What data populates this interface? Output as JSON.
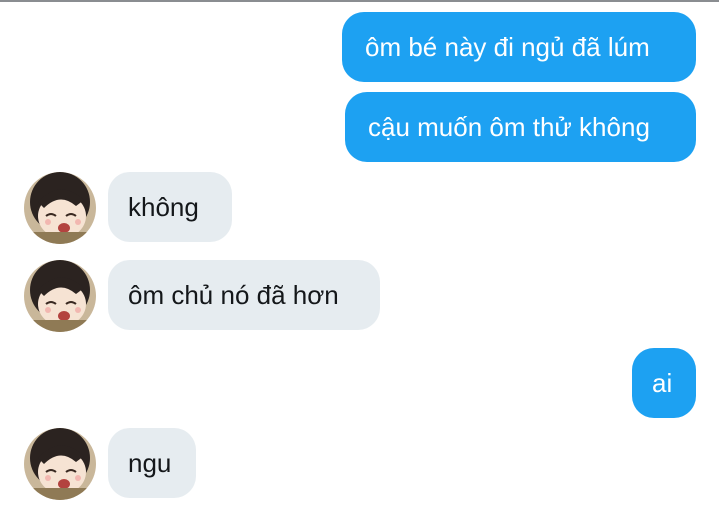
{
  "conversation": {
    "messages": [
      {
        "direction": "outgoing",
        "text": "ôm bé này đi ngủ đã lúm"
      },
      {
        "direction": "outgoing",
        "text": "cậu muốn ôm thử không"
      },
      {
        "direction": "incoming",
        "text": "không",
        "avatar": "anime-girl-avatar"
      },
      {
        "direction": "incoming",
        "text": "ôm chủ nó đã hơn",
        "avatar": "anime-girl-avatar"
      },
      {
        "direction": "outgoing",
        "text": "ai"
      },
      {
        "direction": "incoming",
        "text": "ngu",
        "avatar": "anime-girl-avatar"
      }
    ]
  },
  "colors": {
    "outgoing_bubble": "#1da1f2",
    "incoming_bubble": "#e6ecf0",
    "outgoing_text": "#ffffff",
    "incoming_text": "#14171a"
  }
}
